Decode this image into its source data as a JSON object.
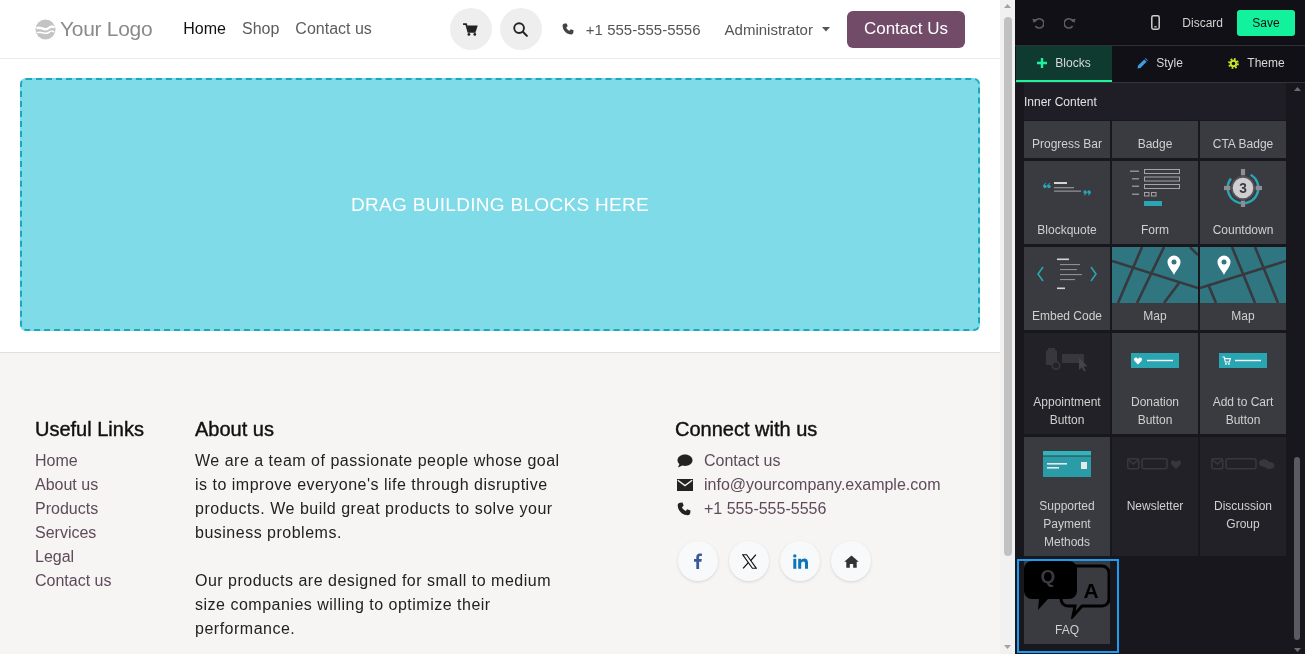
{
  "header": {
    "logo": "Your Logo",
    "nav": [
      {
        "label": "Home",
        "selected": true
      },
      {
        "label": "Shop",
        "selected": false
      },
      {
        "label": "Contact us",
        "selected": false
      }
    ],
    "phone": "+1 555-555-5556",
    "user_menu": "Administrator",
    "cta": "Contact Us"
  },
  "drop_zone": {
    "label": "DRAG BUILDING BLOCKS HERE"
  },
  "footer": {
    "useful_links": {
      "title": "Useful Links",
      "links": [
        "Home",
        "About us",
        "Products",
        "Services",
        "Legal",
        "Contact us"
      ]
    },
    "about": {
      "title": "About us",
      "paragraphs": [
        "We are a team of passionate people whose goal is to improve everyone's life through disruptive products. We build great products to solve your business problems.",
        "Our products are designed for small to medium size companies willing to optimize their performance."
      ]
    },
    "connect": {
      "title": "Connect with us",
      "items": [
        {
          "kind": "chat",
          "label": "Contact us"
        },
        {
          "kind": "email",
          "label": "info@yourcompany.example.com"
        },
        {
          "kind": "phone",
          "label": "+1 555-555-5556"
        }
      ],
      "social": [
        {
          "kind": "facebook"
        },
        {
          "kind": "x"
        },
        {
          "kind": "linkedin"
        },
        {
          "kind": "home"
        }
      ]
    }
  },
  "editor": {
    "toolbar": {
      "discard": "Discard",
      "save": "Save"
    },
    "tabs": [
      {
        "label": "Blocks",
        "kind": "plus",
        "selected": true
      },
      {
        "label": "Style",
        "kind": "pencil",
        "selected": false
      },
      {
        "label": "Theme",
        "kind": "gear",
        "selected": false
      }
    ],
    "section": "Inner Content",
    "blocks": [
      {
        "label": "Progress Bar",
        "kind": "clipped",
        "disabled": false,
        "selected": false
      },
      {
        "label": "Badge",
        "kind": "clipped",
        "disabled": false,
        "selected": false
      },
      {
        "label": "CTA Badge",
        "kind": "clipped",
        "disabled": false,
        "selected": false
      },
      {
        "label": "Blockquote",
        "kind": "blockquote",
        "disabled": false,
        "selected": false
      },
      {
        "label": "Form",
        "kind": "form",
        "disabled": false,
        "selected": false
      },
      {
        "label": "Countdown",
        "kind": "countdown",
        "glyph": "3",
        "disabled": false,
        "selected": false
      },
      {
        "label": "Embed Code",
        "kind": "embed",
        "disabled": false,
        "selected": false
      },
      {
        "label": "Map",
        "kind": "map",
        "flipped": false,
        "disabled": false,
        "selected": false
      },
      {
        "label": "Map",
        "kind": "map",
        "flipped": true,
        "disabled": false,
        "selected": false
      },
      {
        "label": "Appointment Button",
        "kind": "appointment",
        "disabled": true,
        "selected": false
      },
      {
        "label": "Donation Button",
        "kind": "donation",
        "disabled": false,
        "selected": false
      },
      {
        "label": "Add to Cart Button",
        "kind": "cart",
        "disabled": false,
        "selected": false
      },
      {
        "label": "Supported Payment Methods",
        "kind": "payment",
        "disabled": false,
        "selected": false
      },
      {
        "label": "Newsletter",
        "kind": "newsletter",
        "disabled": true,
        "selected": false
      },
      {
        "label": "Discussion Group",
        "kind": "discussion",
        "disabled": true,
        "selected": false
      },
      {
        "label": "FAQ",
        "kind": "faq",
        "glyphs": [
          "Q",
          "A"
        ],
        "disabled": false,
        "selected": true
      }
    ]
  }
}
